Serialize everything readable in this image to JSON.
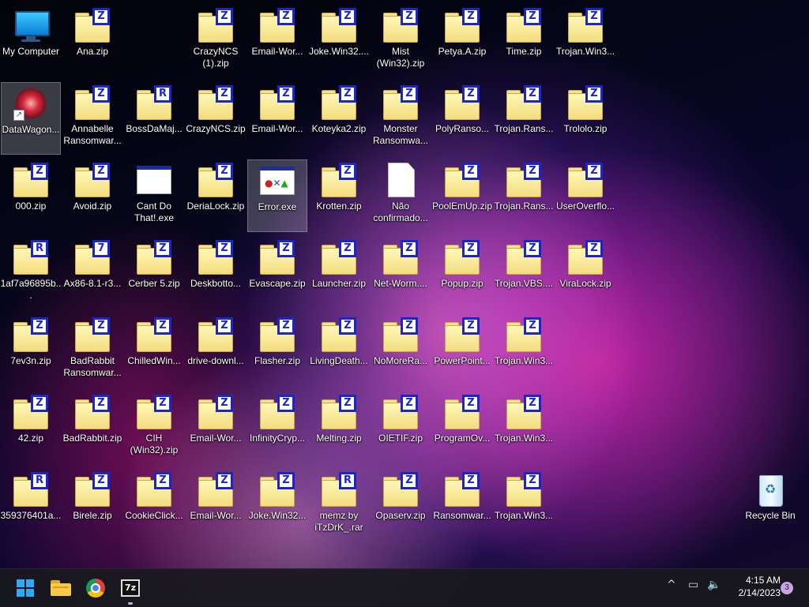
{
  "desktop": {
    "my_computer": "My Computer",
    "datawagon": "DataWagon...",
    "recycle_bin": "Recycle Bin",
    "col1": [
      "Ana.zip",
      "Annabelle Ransomwar...",
      "Avoid.zip",
      "Ax86-8.1-r3...",
      "BadRabbit Ransomwar...",
      "BadRabbit.zip",
      "Birele.zip"
    ],
    "col1_badges": [
      "Z",
      "Z",
      "Z",
      "7",
      "Z",
      "Z",
      "Z"
    ],
    "col2": [
      "BossDaMaj...",
      "Cant Do That!.exe",
      "Cerber 5.zip",
      "ChilledWin...",
      "CIH (Win32).zip",
      "CookieClick..."
    ],
    "col2_badges": [
      "R",
      "",
      "Z",
      "Z",
      "Z",
      "Z"
    ],
    "col3": [
      "CrazyNCS (1).zip",
      "CrazyNCS.zip",
      "DeriaLock.zip",
      "Deskbotto...",
      "drive-downl...",
      "Email-Wor...",
      "Email-Wor..."
    ],
    "col4": [
      "Email-Wor...",
      "Email-Wor...",
      "Error.exe",
      "Evascape.zip",
      "Flasher.zip",
      "InfinityCryp...",
      "Joke.Win32..."
    ],
    "col5": [
      "Joke.Win32....",
      "Koteyka2.zip",
      "Krotten.zip",
      "Launcher.zip",
      "LivingDeath...",
      "Melting.zip",
      "memz by iTzDrK_.rar"
    ],
    "col5_badges": [
      "Z",
      "Z",
      "Z",
      "Z",
      "Z",
      "Z",
      "R"
    ],
    "col6": [
      "Mist (Win32).zip",
      "Monster Ransomwa...",
      "Não confirmado...",
      "Net-Worm....",
      "NoMoreRa...",
      "OIETIF.zip",
      "Opaserv.zip"
    ],
    "col7": [
      "Petya.A.zip",
      "PolyRanso...",
      "PoolEmUp.zip",
      "Popup.zip",
      "PowerPoint...",
      "ProgramOv...",
      "Ransomwar..."
    ],
    "col8": [
      "Time.zip",
      "Trojan.Rans...",
      "Trojan.Rans...",
      "Trojan.VBS....",
      "Trojan.Win3...",
      "Trojan.Win3...",
      "Trojan.Win3..."
    ],
    "col9": [
      "Trojan.Win3...",
      "Trololo.zip",
      "UserOverflo...",
      "ViraLock.zip"
    ],
    "col0": [
      "000.zip",
      "1af7a96895b...",
      "7ev3n.zip",
      "42.zip",
      "359376401a..."
    ],
    "col0_badges": [
      "Z",
      "R",
      "Z",
      "Z",
      "R"
    ]
  },
  "taskbar": {
    "sevenzip_label": "7z",
    "time": "4:15 AM",
    "date": "2/14/2023",
    "notifications": "3"
  },
  "colors": {
    "accent": "#2fa8f5",
    "zip_badge": "#1b27c4"
  }
}
